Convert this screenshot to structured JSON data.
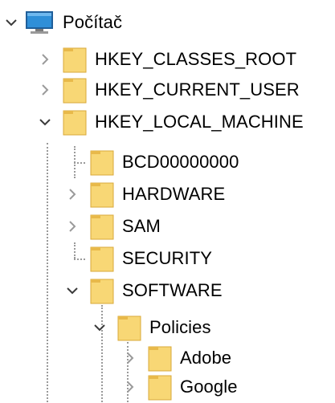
{
  "colors": {
    "folder_body": "#f8d775",
    "folder_tab": "#e8b94a",
    "folder_outline": "#d9a83a",
    "chevron": "#8a8a8a",
    "chevron_expanded": "#3a3a3a",
    "monitor_screen": "#2f8fd8",
    "monitor_frame": "#1f5f9a",
    "guide": "#9a9a9a"
  },
  "tree": {
    "root": {
      "label": "Počítač",
      "icon": "computer-icon",
      "expanded": true
    },
    "hkcr": {
      "label": "HKEY_CLASSES_ROOT",
      "icon": "folder-icon",
      "expanded": false
    },
    "hkcu": {
      "label": "HKEY_CURRENT_USER",
      "icon": "folder-icon",
      "expanded": false
    },
    "hklm": {
      "label": "HKEY_LOCAL_MACHINE",
      "icon": "folder-icon",
      "expanded": true
    },
    "bcd": {
      "label": "BCD00000000",
      "icon": "folder-icon",
      "expanded": false
    },
    "hardware": {
      "label": "HARDWARE",
      "icon": "folder-icon",
      "expanded": false
    },
    "sam": {
      "label": "SAM",
      "icon": "folder-icon",
      "expanded": false
    },
    "security": {
      "label": "SECURITY",
      "icon": "folder-icon",
      "expanded": false
    },
    "software": {
      "label": "SOFTWARE",
      "icon": "folder-icon",
      "expanded": true
    },
    "policies": {
      "label": "Policies",
      "icon": "folder-icon",
      "expanded": true
    },
    "adobe": {
      "label": "Adobe",
      "icon": "folder-icon",
      "expanded": false
    },
    "google": {
      "label": "Google",
      "icon": "folder-icon",
      "expanded": false
    }
  }
}
